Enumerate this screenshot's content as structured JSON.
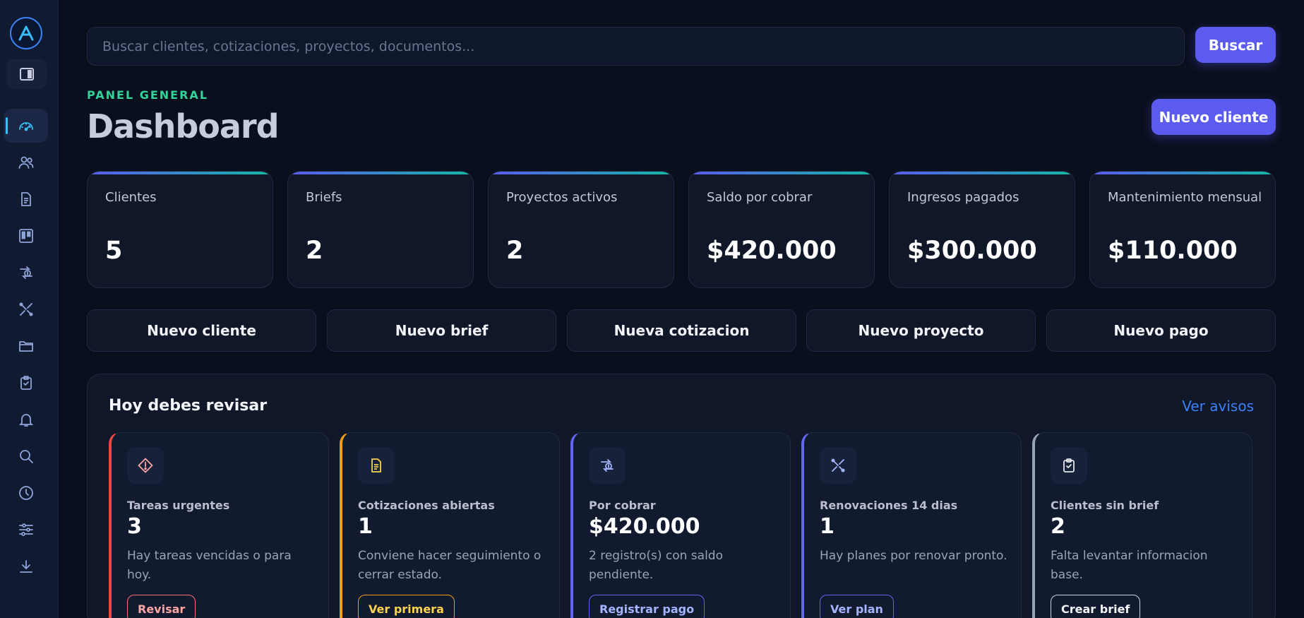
{
  "search": {
    "placeholder": "Buscar clientes, cotizaciones, proyectos, documentos...",
    "button_label": "Buscar"
  },
  "header": {
    "kicker": "PANEL GENERAL",
    "title": "Dashboard",
    "new_client_label": "Nuevo cliente"
  },
  "sidebar": {
    "logo_icon": "logo-a-icon",
    "collapse_icon": "sidebar-toggle-icon",
    "items": [
      {
        "icon": "dashboard-gauge-icon",
        "active": true
      },
      {
        "icon": "users-icon",
        "active": false
      },
      {
        "icon": "document-icon",
        "active": false
      },
      {
        "icon": "kanban-icon",
        "active": false
      },
      {
        "icon": "money-exchange-icon",
        "active": false
      },
      {
        "icon": "tools-icon",
        "active": false
      },
      {
        "icon": "folder-icon",
        "active": false
      },
      {
        "icon": "clipboard-check-icon",
        "active": false
      },
      {
        "icon": "bell-icon",
        "active": false
      },
      {
        "icon": "search-icon",
        "active": false
      },
      {
        "icon": "clock-icon",
        "active": false
      },
      {
        "icon": "sliders-icon",
        "active": false
      },
      {
        "icon": "download-icon",
        "active": false
      }
    ]
  },
  "stats": [
    {
      "label": "Clientes",
      "value": "5"
    },
    {
      "label": "Briefs",
      "value": "2"
    },
    {
      "label": "Proyectos activos",
      "value": "2"
    },
    {
      "label": "Saldo por cobrar",
      "value": "$420.000"
    },
    {
      "label": "Ingresos pagados",
      "value": "$300.000"
    },
    {
      "label": "Mantenimiento mensual",
      "value": "$110.000"
    }
  ],
  "quick_actions": [
    "Nuevo cliente",
    "Nuevo brief",
    "Nueva cotizacion",
    "Nuevo proyecto",
    "Nuevo pago"
  ],
  "review": {
    "title": "Hoy debes revisar",
    "link_label": "Ver avisos",
    "cards": [
      {
        "icon": "warning-diamond-icon",
        "label": "Tareas urgentes",
        "value": "3",
        "description": "Hay tareas vencidas o para hoy.",
        "button": "Revisar",
        "accent": "#ef4444"
      },
      {
        "icon": "document-icon",
        "label": "Cotizaciones abiertas",
        "value": "1",
        "description": "Conviene hacer seguimiento o cerrar estado.",
        "button": "Ver primera",
        "accent": "#f59e0b"
      },
      {
        "icon": "money-exchange-icon",
        "label": "Por cobrar",
        "value": "$420.000",
        "description": "2 registro(s) con saldo pendiente.",
        "button": "Registrar pago",
        "accent": "#6366f1"
      },
      {
        "icon": "tools-icon",
        "label": "Renovaciones 14 dias",
        "value": "1",
        "description": "Hay planes por renovar pronto.",
        "button": "Ver plan",
        "accent": "#6366f1"
      },
      {
        "icon": "clipboard-check-icon",
        "label": "Clientes sin brief",
        "value": "2",
        "description": "Falta levantar informacion base.",
        "button": "Crear brief",
        "accent": "#94a3b8"
      }
    ]
  },
  "colors": {
    "background": "#0a0f1e",
    "sidebar": "#101a31",
    "primary": "#5b5bf0",
    "accent_teal": "#34d399",
    "link": "#3b82f6"
  }
}
